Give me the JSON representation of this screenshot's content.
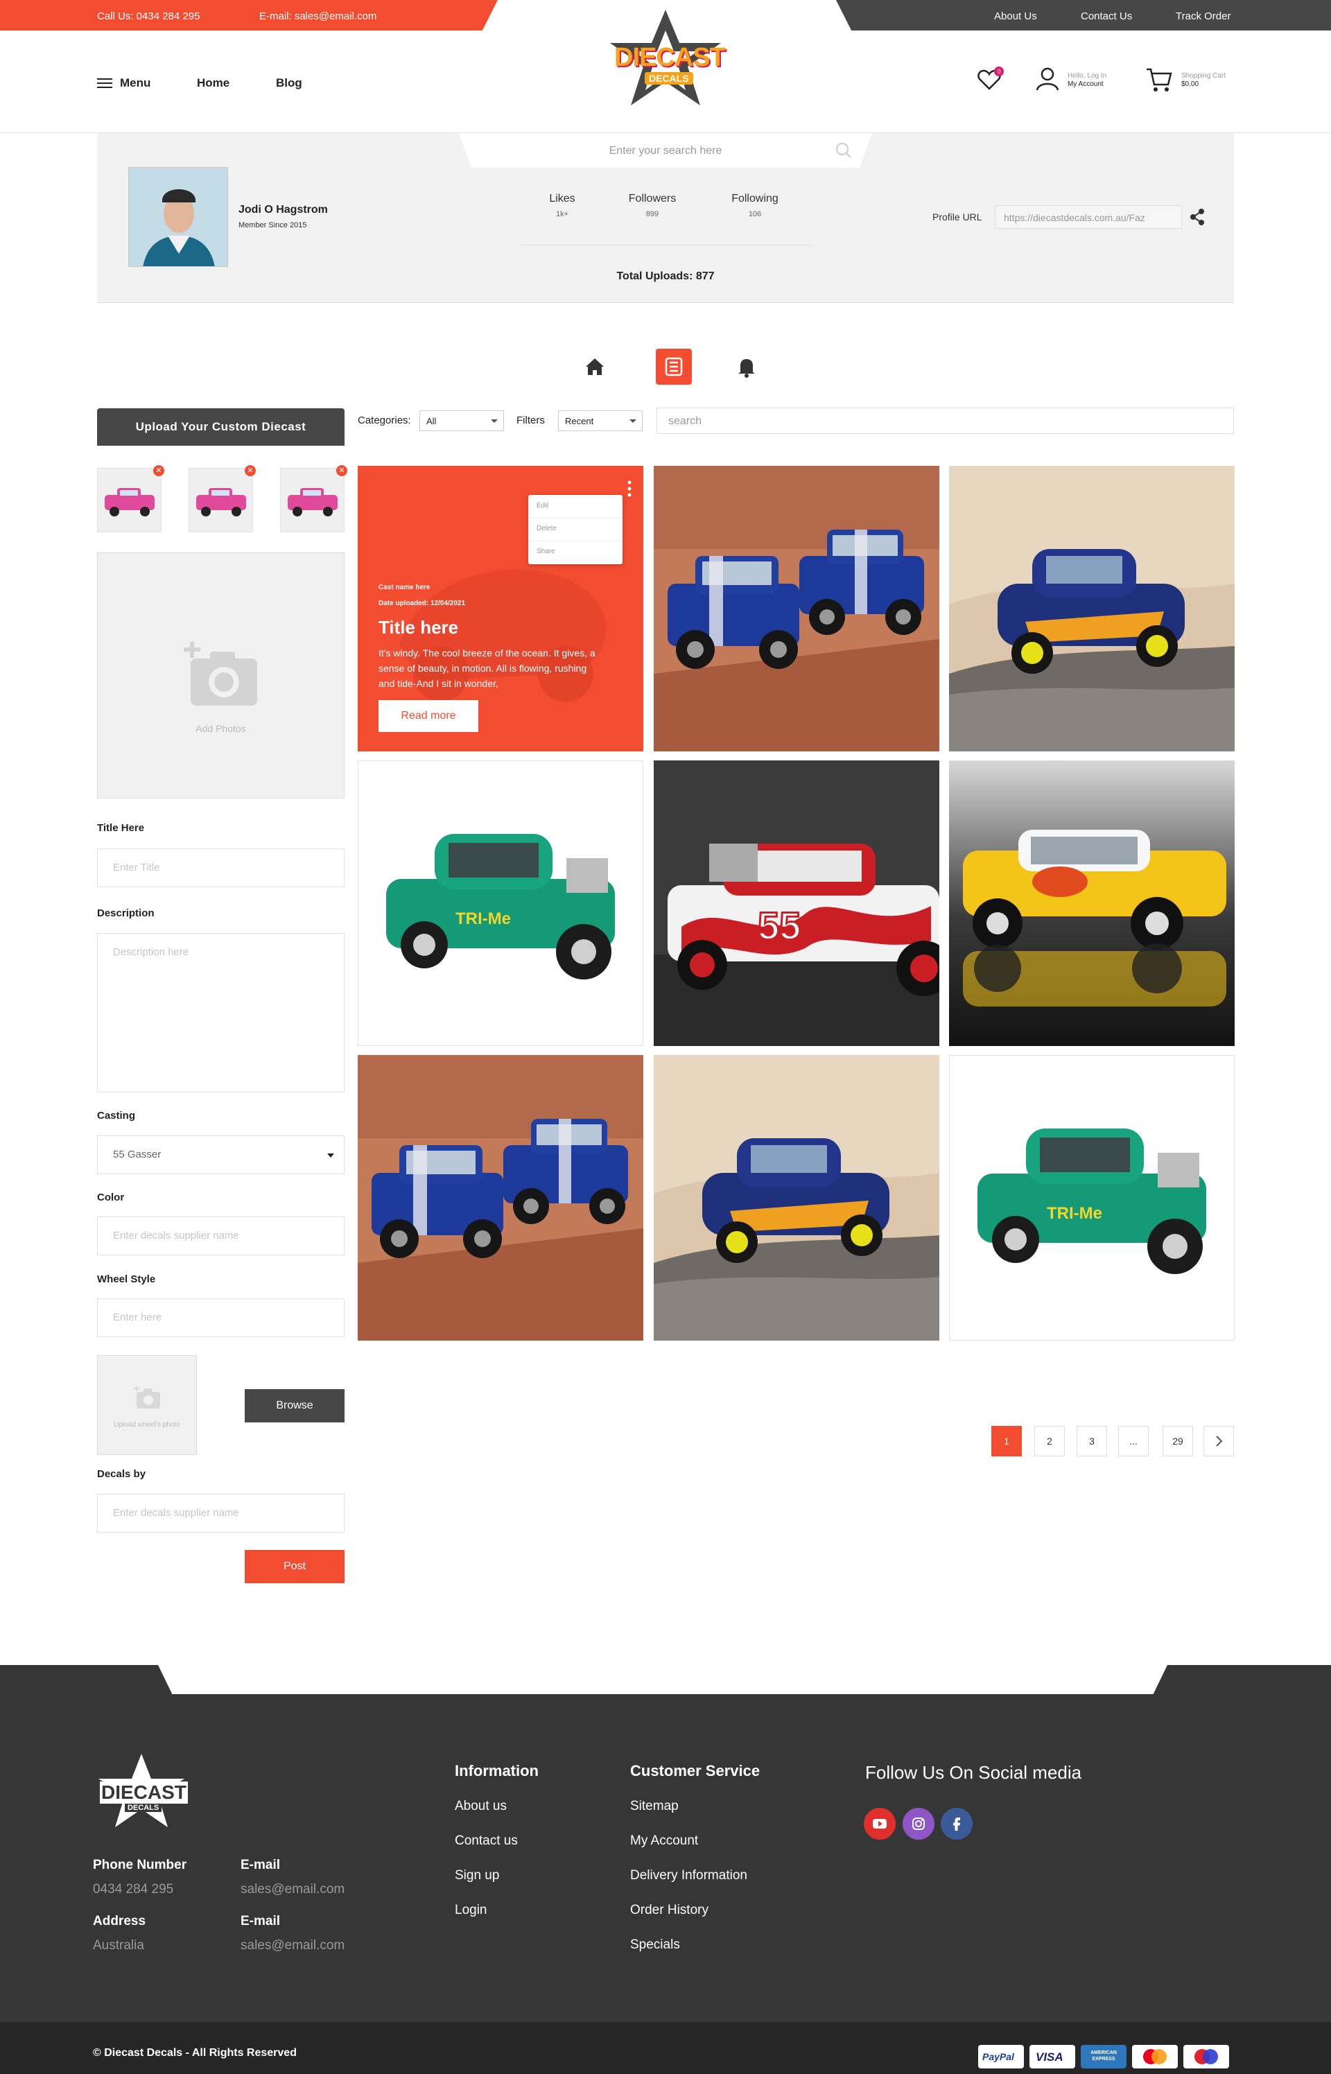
{
  "topbar": {
    "phone": "Call Us: 0434 284 295",
    "email": "E-mail: sales@email.com",
    "links": [
      "About Us",
      "Contact Us",
      "Track Order"
    ]
  },
  "header": {
    "menu": "Menu",
    "home": "Home",
    "blog": "Blog",
    "logo_main": "DIECAST",
    "logo_sub": "DECALS",
    "wishlist_count": "0",
    "account_line1": "Hello, Log In",
    "account_line2": "My Account",
    "cart_line1": "Shopping Cart",
    "cart_line2": "$0.00"
  },
  "search": {
    "placeholder": "Enter your search here"
  },
  "profile": {
    "name": "Jodi O Hagstrom",
    "member_since": "Member Since 2015",
    "stats": [
      {
        "label": "Likes",
        "value": "1k+"
      },
      {
        "label": "Followers",
        "value": "899"
      },
      {
        "label": "Following",
        "value": "106"
      }
    ],
    "total_uploads": "Total Uploads: 877",
    "url_label": "Profile URL",
    "url_value": "https://diecastdecals.com.au/Faz"
  },
  "sidebar": {
    "upload_title": "Upload  Your Custom Diecast",
    "add_photos": "Add Photos",
    "title_label": "Title Here",
    "title_placeholder": "Enter Title",
    "description_label": "Description",
    "description_placeholder": "Description here",
    "casting_label": "Casting",
    "casting_value": "55 Gasser",
    "color_label": "Color",
    "color_placeholder": "Enter decals supplier name",
    "wheel_label": "Wheel Style",
    "wheel_placeholder": "Enter here",
    "wheel_photo": "Upload wheel's photo",
    "browse": "Browse",
    "decals_label": "Decals by",
    "decals_placeholder": "Enter decals supplier name",
    "post": "Post"
  },
  "filters": {
    "categories_label": "Categories:",
    "categories_value": "All",
    "filters_label": "Filters",
    "filters_value": "Recent",
    "search_placeholder": "search"
  },
  "featured": {
    "menu_items": [
      "Edit",
      "Delete",
      "Share"
    ],
    "cast_name": "Cast name here",
    "date": "Date uploaded: 12/04/2021",
    "title": "Title here",
    "text": "It's windy. The cool breeze of the ocean. It gives, a sense of beauty, in motion. All is flowing, rushing and tide-And I sit in wonder,",
    "read_more": "Read more"
  },
  "gallery": [
    {
      "scene": "two blue cars on brick"
    },
    {
      "scene": "blue gasser on rock"
    },
    {
      "scene": "green gasser on white",
      "decal": "TRI-Me"
    },
    {
      "scene": "white gasser red flames",
      "decal": "55"
    },
    {
      "scene": "yellow gasser reflection"
    },
    {
      "scene": "two blue cars on brick"
    },
    {
      "scene": "blue gasser on rock"
    },
    {
      "scene": "green gasser on white",
      "decal": "TRI-Me"
    }
  ],
  "pagination": [
    "1",
    "2",
    "3",
    "...",
    "29"
  ],
  "footer": {
    "logo_main": "DIECAST",
    "logo_sub": "DECALS",
    "phone_label": "Phone Number",
    "phone_value": "0434 284 295",
    "email_label": "E-mail",
    "email_value": "sales@email.com",
    "address_label": "Address",
    "address_value": "Australia",
    "email2_label": "E-mail",
    "email2_value": "sales@email.com",
    "info_title": "Information",
    "info_links": [
      "About us",
      "Contact us",
      "Sign up",
      "Login"
    ],
    "cs_title": "Customer Service",
    "cs_links": [
      "Sitemap",
      "My Account",
      "Delivery Information",
      "Order History",
      "Specials"
    ],
    "social_title": "Follow Us On Social media",
    "copyright": "© Diecast Decals - All Rights Reserved",
    "payments": [
      "PayPal",
      "VISA",
      "AMERICAN EXPRESS",
      "mastercard",
      "maestro"
    ]
  },
  "colors": {
    "accent": "#f24c31",
    "dark": "#474747",
    "footer": "#363636"
  }
}
